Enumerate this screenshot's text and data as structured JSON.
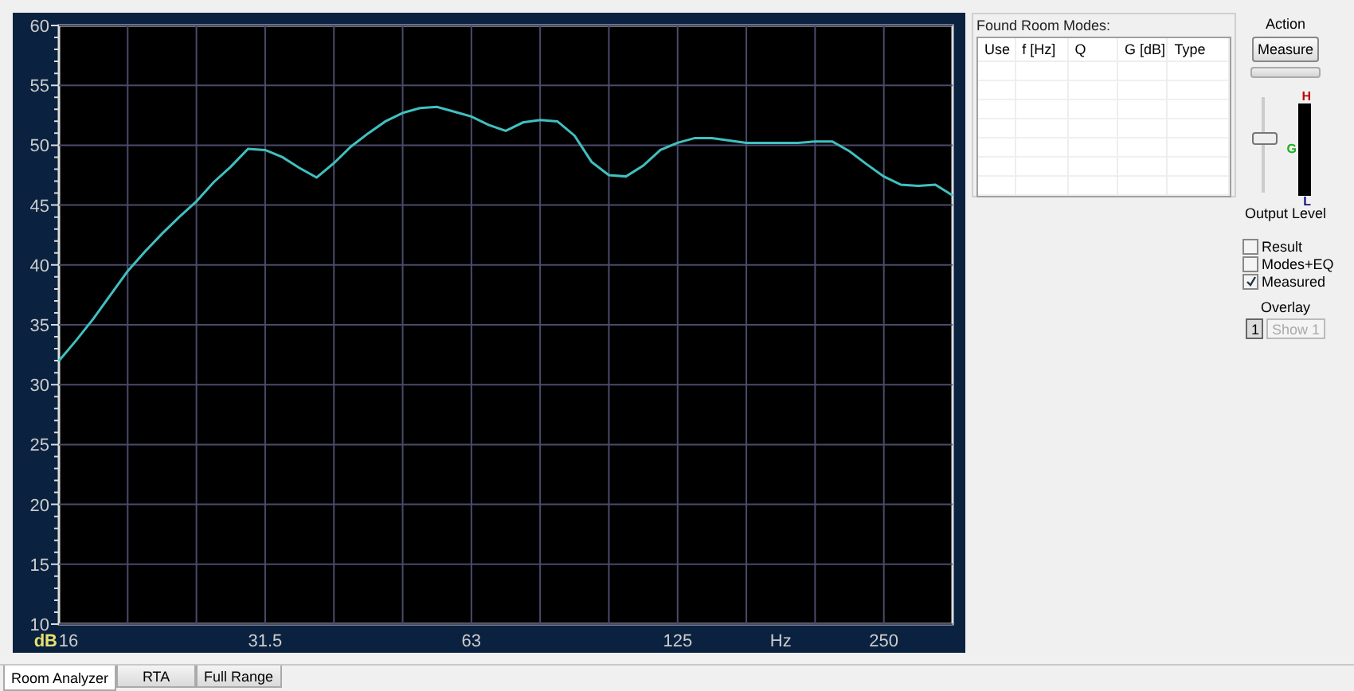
{
  "chart": {
    "chart_data": {
      "type": "line",
      "grid": true,
      "xlabel": "Hz",
      "ylabel": "dB",
      "ylim": [
        10,
        60
      ],
      "yticks": [
        10,
        15,
        20,
        25,
        30,
        35,
        40,
        45,
        50,
        55,
        60
      ],
      "categories": [
        "16",
        null,
        null,
        null,
        null,
        null,
        null,
        null,
        null,
        null,
        null,
        null,
        "31.5",
        null,
        null,
        null,
        null,
        null,
        null,
        null,
        null,
        null,
        null,
        null,
        "63",
        null,
        null,
        null,
        null,
        null,
        null,
        null,
        null,
        null,
        null,
        null,
        "125",
        null,
        null,
        null,
        null,
        null,
        null,
        null,
        null,
        null,
        null,
        null,
        "250",
        null,
        null,
        null,
        null
      ],
      "series": [
        {
          "color": "#40c0c0",
          "values": [
            32,
            33.7,
            35.5,
            37.5,
            39.5,
            41.1,
            42.6,
            44,
            45.3,
            46.9,
            48.2,
            49.7,
            49.6,
            49,
            48.1,
            47.3,
            48.5,
            49.9,
            51,
            52,
            52.7,
            53.1,
            53.2,
            52.8,
            52.4,
            51.7,
            51.2,
            51.9,
            52.1,
            52,
            50.8,
            48.6,
            47.5,
            47.4,
            48.3,
            49.6,
            50.2,
            50.6,
            50.6,
            50.4,
            50.2,
            50.2,
            50.2,
            50.2,
            50.3,
            50.3,
            49.5,
            48.4,
            47.4,
            46.7,
            46.6,
            46.7,
            45.8
          ]
        }
      ]
    }
  },
  "room_modes": {
    "title": "Found Room Modes:",
    "columns": [
      "Use",
      "f [Hz]",
      "Q",
      "G [dB]",
      "Type"
    ]
  },
  "action": {
    "title": "Action",
    "measure_button": "Measure",
    "progress": {
      "level": 0
    },
    "output_slider": {
      "level": 0.6
    },
    "meter_labels": [
      "H",
      "G",
      "L"
    ],
    "output_label": "Output Level"
  },
  "checkboxes": [
    {
      "label": "Result",
      "checked": false
    },
    {
      "label": "Modes+EQ",
      "checked": false
    },
    {
      "label": "Measured",
      "checked": true
    }
  ],
  "overlay": {
    "title": "Overlay",
    "buttons": [
      {
        "label": "1",
        "selected": true,
        "disabled": false
      },
      {
        "label": "Show 1",
        "selected": false,
        "disabled": true
      }
    ]
  },
  "tabs": [
    {
      "label": "Room Analyzer",
      "selected": true
    },
    {
      "label": "RTA",
      "selected": false
    },
    {
      "label": "Full Range",
      "selected": false
    }
  ]
}
